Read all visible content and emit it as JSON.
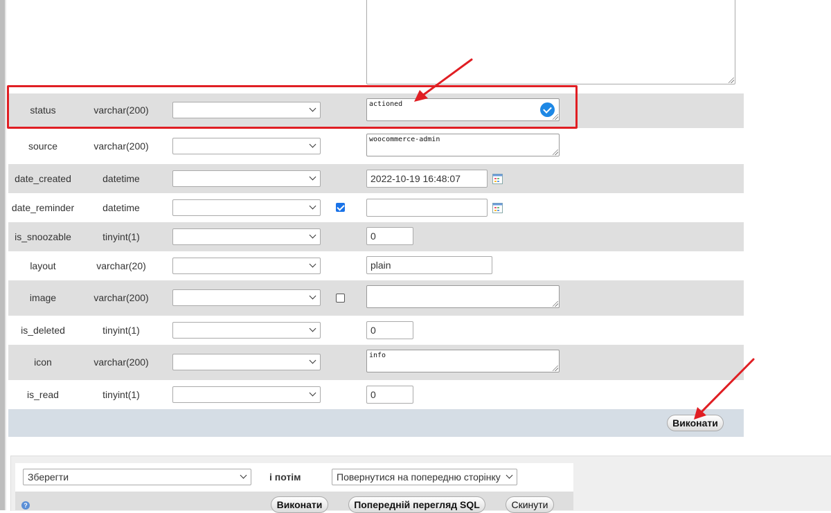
{
  "rows": [
    {
      "name": "status",
      "type": "varchar(200)",
      "value": "actioned"
    },
    {
      "name": "source",
      "type": "varchar(200)",
      "value": "woocommerce-admin"
    },
    {
      "name": "date_created",
      "type": "datetime",
      "value": "2022-10-19 16:48:07"
    },
    {
      "name": "date_reminder",
      "type": "datetime",
      "value": ""
    },
    {
      "name": "is_snoozable",
      "type": "tinyint(1)",
      "value": "0"
    },
    {
      "name": "layout",
      "type": "varchar(20)",
      "value": "plain"
    },
    {
      "name": "image",
      "type": "varchar(200)",
      "value": ""
    },
    {
      "name": "is_deleted",
      "type": "tinyint(1)",
      "value": "0"
    },
    {
      "name": "icon",
      "type": "varchar(200)",
      "value": "info"
    },
    {
      "name": "is_read",
      "type": "tinyint(1)",
      "value": "0"
    }
  ],
  "form": {
    "go_button": "Виконати"
  },
  "bottom": {
    "after_insert_select": "Зберегти",
    "then_label": "і потім",
    "then_select": "Повернутися на попередню сторінку",
    "go_button": "Виконати",
    "preview_sql_button": "Попередній перегляд SQL",
    "reset_button": "Скинути",
    "help_icon_glyph": "?"
  },
  "colors": {
    "annotation": "#e01e23",
    "accent": "#1e88e5"
  }
}
